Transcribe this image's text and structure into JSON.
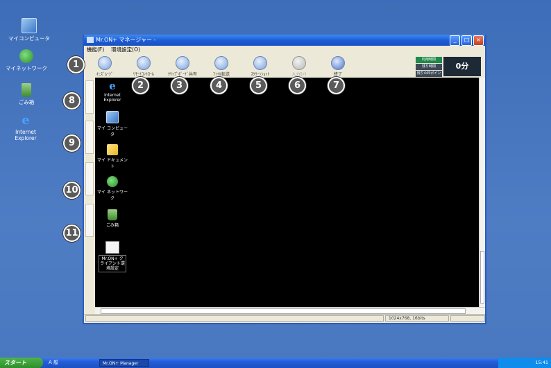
{
  "desktop": {
    "icons": [
      {
        "label": "マイコンピュータ",
        "icon": "computer-icon"
      },
      {
        "label": "マイネットワーク",
        "icon": "network-icon"
      },
      {
        "label": "ごみ箱",
        "icon": "recycle-bin-icon"
      },
      {
        "label": "Internet Explorer",
        "icon": "internet-explorer-icon"
      }
    ]
  },
  "window": {
    "title": "Mr.ON+ マネージャー - ",
    "menu": [
      "機能(F)",
      "環境設定(O)"
    ],
    "toolbar": [
      {
        "label": "ｷﾆｽﾞﾑｰｼﾞ",
        "icon": "monitor-icon",
        "enabled": true
      },
      {
        "label": "ﾘﾓｰﾄｺﾝﾄﾛｰﾙ",
        "icon": "remote-control-icon",
        "enabled": true
      },
      {
        "label": "ｸﾘｯﾌﾟﾎﾞｰﾄﾞ共有",
        "icon": "clipboard-icon",
        "enabled": true
      },
      {
        "label": "ﾌｧｲﾙ転送",
        "icon": "file-transfer-icon",
        "enabled": true
      },
      {
        "label": "ｽｸﾘｰﾝｼｮｯﾄ",
        "icon": "camera-icon",
        "enabled": true
      },
      {
        "label": "入力ﾛｯｸ",
        "icon": "lock-icon",
        "enabled": false
      },
      {
        "label": "終了",
        "icon": "close-icon",
        "enabled": true
      }
    ],
    "timer": {
      "rows": [
        "利用時間",
        "残り時間",
        "残り445ポイント"
      ],
      "value": "0分"
    },
    "remote_icons": [
      {
        "label": "Internet Explorer",
        "icon": "internet-explorer-icon"
      },
      {
        "label": "マイ コンピュータ",
        "icon": "computer-icon"
      },
      {
        "label": "マイ ドキュメント",
        "icon": "documents-icon"
      },
      {
        "label": "マイ ネットワーク",
        "icon": "network-icon"
      },
      {
        "label": "ごみ箱",
        "icon": "recycle-bin-icon"
      },
      {
        "label": "Mr.ON+ クライアント環境設定",
        "icon": "settings-icon"
      }
    ],
    "status": {
      "resolution": "1024x768, 16bits"
    }
  },
  "callouts": [
    "1",
    "2",
    "3",
    "4",
    "5",
    "6",
    "7",
    "8",
    "9",
    "10",
    "11"
  ],
  "taskbar": {
    "start_label": "スタート",
    "quick_launch": "A 般 ",
    "task_label": "Mr.ON+ Manager",
    "clock": "15:41"
  },
  "colors": {
    "accent": "#2a5cc4",
    "remote_bg": "#000000",
    "timer_active": "#1f8a4c"
  }
}
